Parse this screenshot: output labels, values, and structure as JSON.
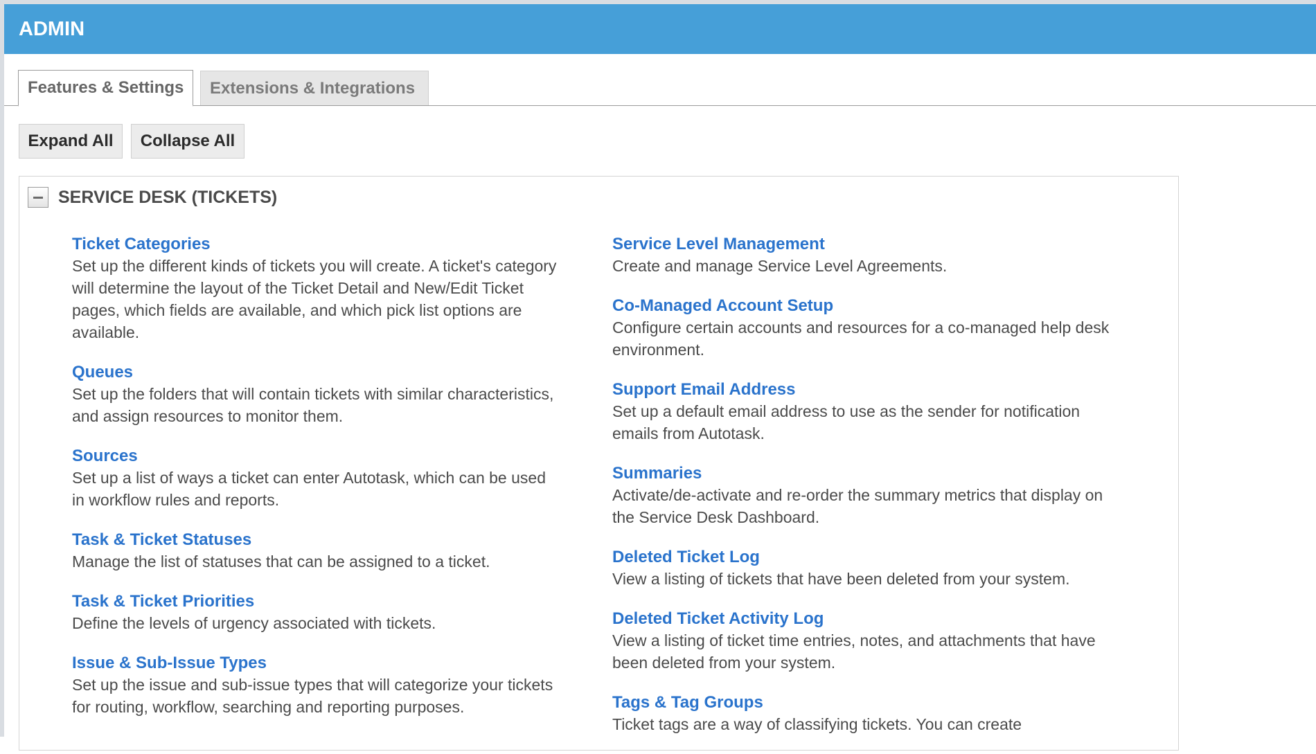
{
  "header": {
    "title": "ADMIN"
  },
  "tabs": [
    {
      "label": "Features & Settings",
      "active": true
    },
    {
      "label": "Extensions & Integrations",
      "active": false
    }
  ],
  "toolbar": {
    "expand_label": "Expand All",
    "collapse_label": "Collapse All"
  },
  "section": {
    "title": "SERVICE DESK (TICKETS)",
    "left_items": [
      {
        "title": "Ticket Categories",
        "desc": "Set up the different kinds of tickets you will create. A ticket's category will determine the layout of the Ticket Detail and New/Edit Ticket pages, which fields are available, and which pick list options are available."
      },
      {
        "title": "Queues",
        "desc": "Set up the folders that will contain tickets with similar characteristics, and assign resources to monitor them."
      },
      {
        "title": "Sources",
        "desc": "Set up a list of ways a ticket can enter Autotask, which can be used in workflow rules and reports."
      },
      {
        "title": "Task & Ticket Statuses",
        "desc": "Manage the list of statuses that can be assigned to a ticket."
      },
      {
        "title": "Task & Ticket Priorities",
        "desc": "Define the levels of urgency associated with tickets."
      },
      {
        "title": "Issue & Sub-Issue Types",
        "desc": "Set up the issue and sub-issue types that will categorize your tickets for routing, workflow, searching and reporting purposes."
      }
    ],
    "right_items": [
      {
        "title": "Service Level Management",
        "desc": "Create and manage Service Level Agreements."
      },
      {
        "title": "Co-Managed Account Setup",
        "desc": "Configure certain accounts and resources for a co-managed help desk environment."
      },
      {
        "title": "Support Email Address",
        "desc": "Set up a default email address to use as the sender for notification emails from Autotask."
      },
      {
        "title": "Summaries",
        "desc": "Activate/de-activate and re-order the summary metrics that display on the Service Desk Dashboard."
      },
      {
        "title": "Deleted Ticket Log",
        "desc": "View a listing of tickets that have been deleted from your system."
      },
      {
        "title": "Deleted Ticket Activity Log",
        "desc": "View a listing of ticket time entries, notes, and attachments that have been deleted from your system."
      },
      {
        "title": "Tags & Tag Groups",
        "desc": "Ticket tags are a way of classifying tickets. You can create"
      }
    ]
  },
  "colors": {
    "header_bg": "#469fd8",
    "link": "#2a73cc",
    "text": "#4a4a4a"
  }
}
